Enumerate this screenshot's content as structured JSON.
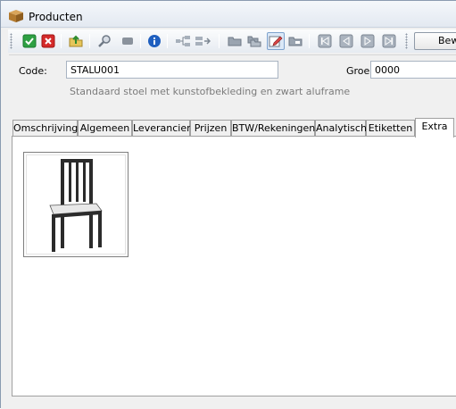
{
  "window": {
    "title": "Producten",
    "title_icon": "box-icon"
  },
  "toolbar": {
    "buttons": [
      {
        "name": "confirm-button",
        "icon": "green-check-icon"
      },
      {
        "name": "cancel-button",
        "icon": "red-x-icon"
      },
      {
        "name": "export-button",
        "icon": "folder-up-icon"
      },
      {
        "name": "search-button",
        "icon": "magnifier-icon"
      },
      {
        "name": "disabled-button",
        "icon": "gray-rect-icon"
      },
      {
        "name": "info-button",
        "icon": "info-icon"
      },
      {
        "name": "tree-button",
        "icon": "tree-icon"
      },
      {
        "name": "move-button",
        "icon": "move-icon"
      },
      {
        "name": "open-folder-button",
        "icon": "folder-icon"
      },
      {
        "name": "copy-folder-button",
        "icon": "folders-icon"
      },
      {
        "name": "edit-button",
        "icon": "edit-icon"
      },
      {
        "name": "image-folder-button",
        "icon": "folder-image-icon"
      },
      {
        "name": "first-record-button",
        "icon": "first-icon"
      },
      {
        "name": "previous-record-button",
        "icon": "prev-icon"
      },
      {
        "name": "next-record-button",
        "icon": "next-icon"
      },
      {
        "name": "last-record-button",
        "icon": "last-icon"
      }
    ],
    "edit_label": "Bewerken"
  },
  "header": {
    "code_label": "Code:",
    "code_value": "STALU001",
    "group_label": "Groep:",
    "group_value": "0000",
    "description": "Standaard stoel met kunstofbekleding en zwart aluframe"
  },
  "tabs": [
    {
      "label": "Omschrijving"
    },
    {
      "label": "Algemeen"
    },
    {
      "label": "Leverancier"
    },
    {
      "label": "Prijzen"
    },
    {
      "label": "BTW/Rekeningen"
    },
    {
      "label": "Analytisch"
    },
    {
      "label": "Etiketten"
    },
    {
      "label": "Extra",
      "selected": true
    }
  ],
  "extra": {
    "image": "chair-image",
    "colors": {
      "frame": "#2b2b2b",
      "seat": "#e8e8e8"
    }
  }
}
